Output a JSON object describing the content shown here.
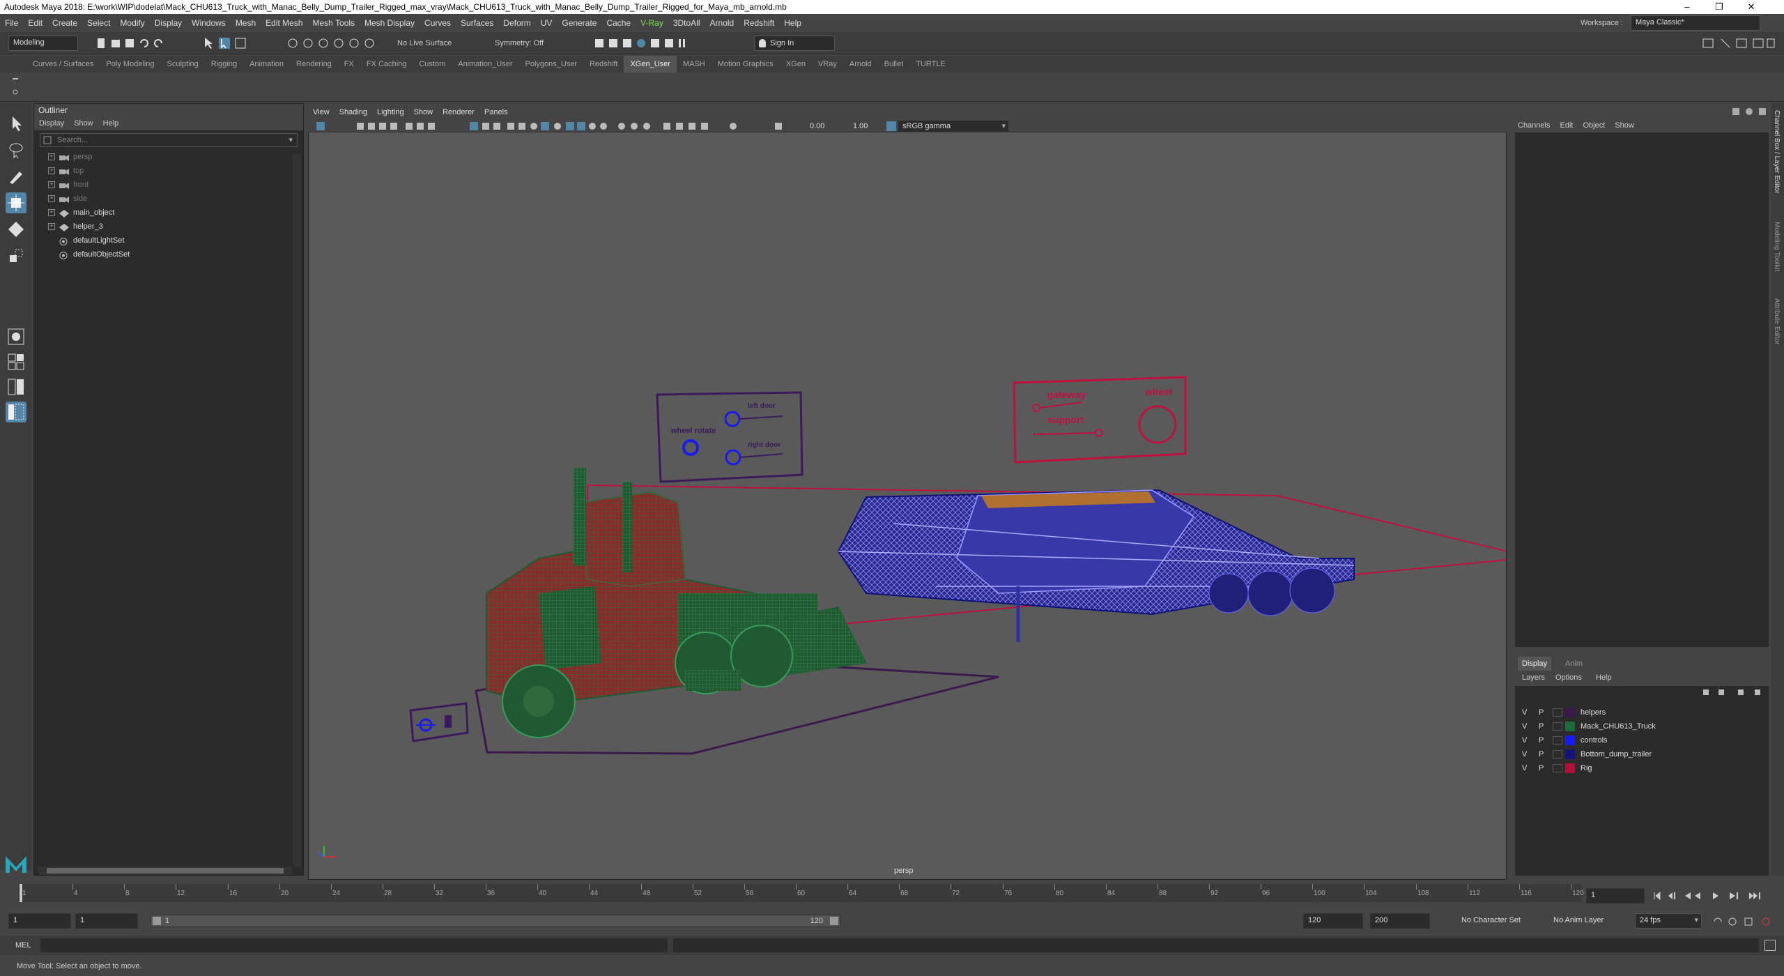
{
  "window": {
    "title": "Autodesk Maya 2018: E:\\work\\WIP\\dodelat\\Mack_CHU613_Truck_with_Manac_Belly_Dump_Trailer_Rigged_max_vray\\Mack_CHU613_Truck_with_Manac_Belly_Dump_Trailer_Rigged_for_Maya_mb_arnold.mb",
    "minimize": "–",
    "restore": "❐",
    "close": "✕"
  },
  "menubar": [
    "File",
    "Edit",
    "Create",
    "Select",
    "Modify",
    "Display",
    "Windows",
    "Mesh",
    "Edit Mesh",
    "Mesh Tools",
    "Mesh Display",
    "Curves",
    "Surfaces",
    "Deform",
    "UV",
    "Generate",
    "Cache",
    "V-Ray",
    "3DtoAll",
    "Arnold",
    "Redshift",
    "Help"
  ],
  "workspace": {
    "label": "Workspace :",
    "value": "Maya Classic*"
  },
  "statusline": {
    "mode": "Modeling",
    "live_surface": "No Live Surface",
    "symmetry": "Symmetry: Off",
    "sign_in": "Sign In"
  },
  "shelf_tabs": [
    "Curves / Surfaces",
    "Poly Modeling",
    "Sculpting",
    "Rigging",
    "Animation",
    "Rendering",
    "FX",
    "FX Caching",
    "Custom",
    "Animation_User",
    "Polygons_User",
    "Redshift",
    "XGen_User",
    "MASH",
    "Motion Graphics",
    "XGen",
    "VRay",
    "Arnold",
    "Bullet",
    "TURTLE"
  ],
  "active_shelf_tab": "XGen_User",
  "outliner": {
    "title": "Outliner",
    "menu": [
      "Display",
      "Show",
      "Help"
    ],
    "search_placeholder": "Search...",
    "items": [
      {
        "label": "persp",
        "icon": "camera-icon",
        "dim": true
      },
      {
        "label": "top",
        "icon": "camera-icon",
        "dim": true
      },
      {
        "label": "front",
        "icon": "camera-icon",
        "dim": true
      },
      {
        "label": "side",
        "icon": "camera-icon",
        "dim": true
      },
      {
        "label": "main_object",
        "icon": "transform-icon",
        "dim": false
      },
      {
        "label": "helper_3",
        "icon": "transform-icon",
        "dim": false
      },
      {
        "label": "defaultLightSet",
        "icon": "set-icon",
        "dim": false
      },
      {
        "label": "defaultObjectSet",
        "icon": "set-icon",
        "dim": false
      }
    ]
  },
  "viewport": {
    "menu": [
      "View",
      "Shading",
      "Lighting",
      "Show",
      "Renderer",
      "Panels"
    ],
    "exposure": "0.00",
    "gamma": "1.00",
    "color_space": "sRGB gamma",
    "camera_label": "persp",
    "labels": {
      "left_panel": {
        "top": "left door",
        "middle": "wheel rotate",
        "bottom": "right door"
      },
      "right_panel": {
        "a": "gateway",
        "b": "support",
        "c": "wheel"
      }
    }
  },
  "channel_box": {
    "menu": [
      "Channels",
      "Edit",
      "Object",
      "Show"
    ]
  },
  "layer_editor": {
    "tabs": [
      "Display",
      "Anim"
    ],
    "menu": [
      "Layers",
      "Options",
      "Help"
    ],
    "layers": [
      {
        "v": "V",
        "p": "P",
        "name": "helpers",
        "color": "#3a1a4a"
      },
      {
        "v": "V",
        "p": "P",
        "name": "Mack_CHU613_Truck",
        "color": "#1f6a3a"
      },
      {
        "v": "V",
        "p": "P",
        "name": "controls",
        "color": "#1a1aee"
      },
      {
        "v": "V",
        "p": "P",
        "name": "Bottom_dump_trailer",
        "color": "#14147a"
      },
      {
        "v": "V",
        "p": "P",
        "name": "Rig",
        "color": "#b0103a"
      }
    ]
  },
  "side_tabs": [
    "Channel Box / Layer Editor",
    "Modeling Toolkit",
    "Attribute Editor"
  ],
  "timeline": {
    "ticks": [
      "1",
      "4",
      "8",
      "12",
      "16",
      "20",
      "24",
      "28",
      "32",
      "36",
      "40",
      "44",
      "48",
      "52",
      "56",
      "60",
      "64",
      "68",
      "72",
      "76",
      "80",
      "84",
      "88",
      "92",
      "96",
      "100",
      "104",
      "108",
      "112",
      "116",
      "120"
    ],
    "current_frame": "1"
  },
  "range": {
    "start": "1",
    "playback_start": "1",
    "range_low": "1",
    "range_high": "120",
    "playback_end": "120",
    "end": "200",
    "character_set": "No Character Set",
    "anim_layer": "No Anim Layer",
    "fps": "24 fps"
  },
  "command": {
    "label": "MEL"
  },
  "help_line": "Move Tool: Select an object to move.",
  "colors": {
    "accent": "#5285a6",
    "truck": "#1f6a3a",
    "truck_red": "#9a2a2a",
    "controls": "#1a1aee",
    "rig": "#c01040",
    "helpers": "#3a1a4a"
  }
}
